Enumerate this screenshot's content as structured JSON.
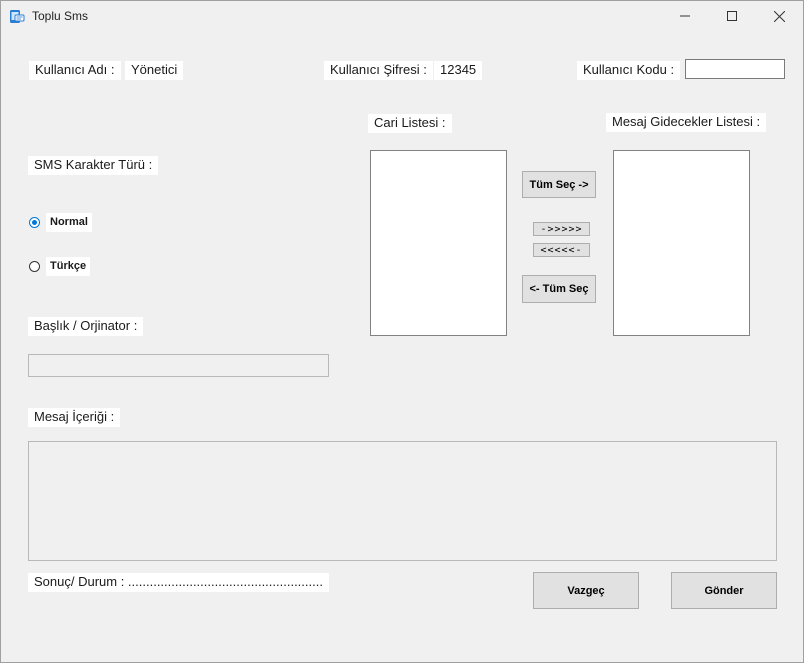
{
  "window": {
    "title": "Toplu Sms"
  },
  "header": {
    "username_label": "Kullanıcı Adı :",
    "username_value": "Yönetici",
    "password_label": "Kullanıcı Şifresi :",
    "password_value": "12345",
    "usercode_label": "Kullanıcı Kodu :",
    "usercode_value": ""
  },
  "sms_type": {
    "label": "SMS Karakter Türü :",
    "options": [
      "Normal",
      "Türkçe"
    ],
    "selected": "Normal"
  },
  "sender": {
    "label": "Başlık / Orjinator :",
    "value": ""
  },
  "lists": {
    "cari_label": "Cari Listesi :",
    "recipients_label": "Mesaj Gidecekler Listesi :"
  },
  "transfer_buttons": {
    "select_all_right": "Tüm Seç ->",
    "move_right": "->>>>>",
    "move_left": "<<<<<-",
    "select_all_left": "<- Tüm Seç"
  },
  "message": {
    "label": "Mesaj İçeriği :",
    "value": ""
  },
  "status": {
    "text": "Sonuç/ Durum : ......................................................"
  },
  "actions": {
    "cancel": "Vazgeç",
    "send": "Gönder"
  }
}
